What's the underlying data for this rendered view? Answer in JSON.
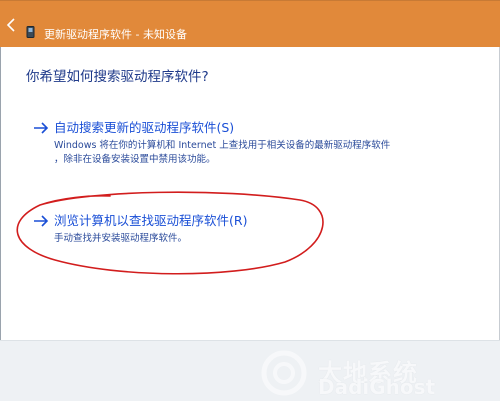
{
  "window": {
    "title": "更新驱动程序软件 - 未知设备",
    "accent_color": "#e1893a"
  },
  "icons": {
    "back": "back-arrow-icon",
    "device": "device-icon",
    "option_arrow": "right-arrow-icon"
  },
  "main": {
    "question": "你希望如何搜索驱动程序软件?",
    "options": [
      {
        "title": "自动搜索更新的驱动程序软件(S)",
        "description_lines": [
          "Windows 将在你的计算机和 Internet 上查找用于相关设备的最新驱动程序软件",
          "，除非在设备安装设置中禁用该功能。"
        ]
      },
      {
        "title": "浏览计算机以查找驱动程序软件(R)",
        "description_lines": [
          "手动查找并安装驱动程序软件。"
        ]
      }
    ]
  },
  "annotation": {
    "color": "#d21d1d"
  },
  "watermark": {
    "text": "大地系统",
    "subtext": "DadiGhost"
  }
}
